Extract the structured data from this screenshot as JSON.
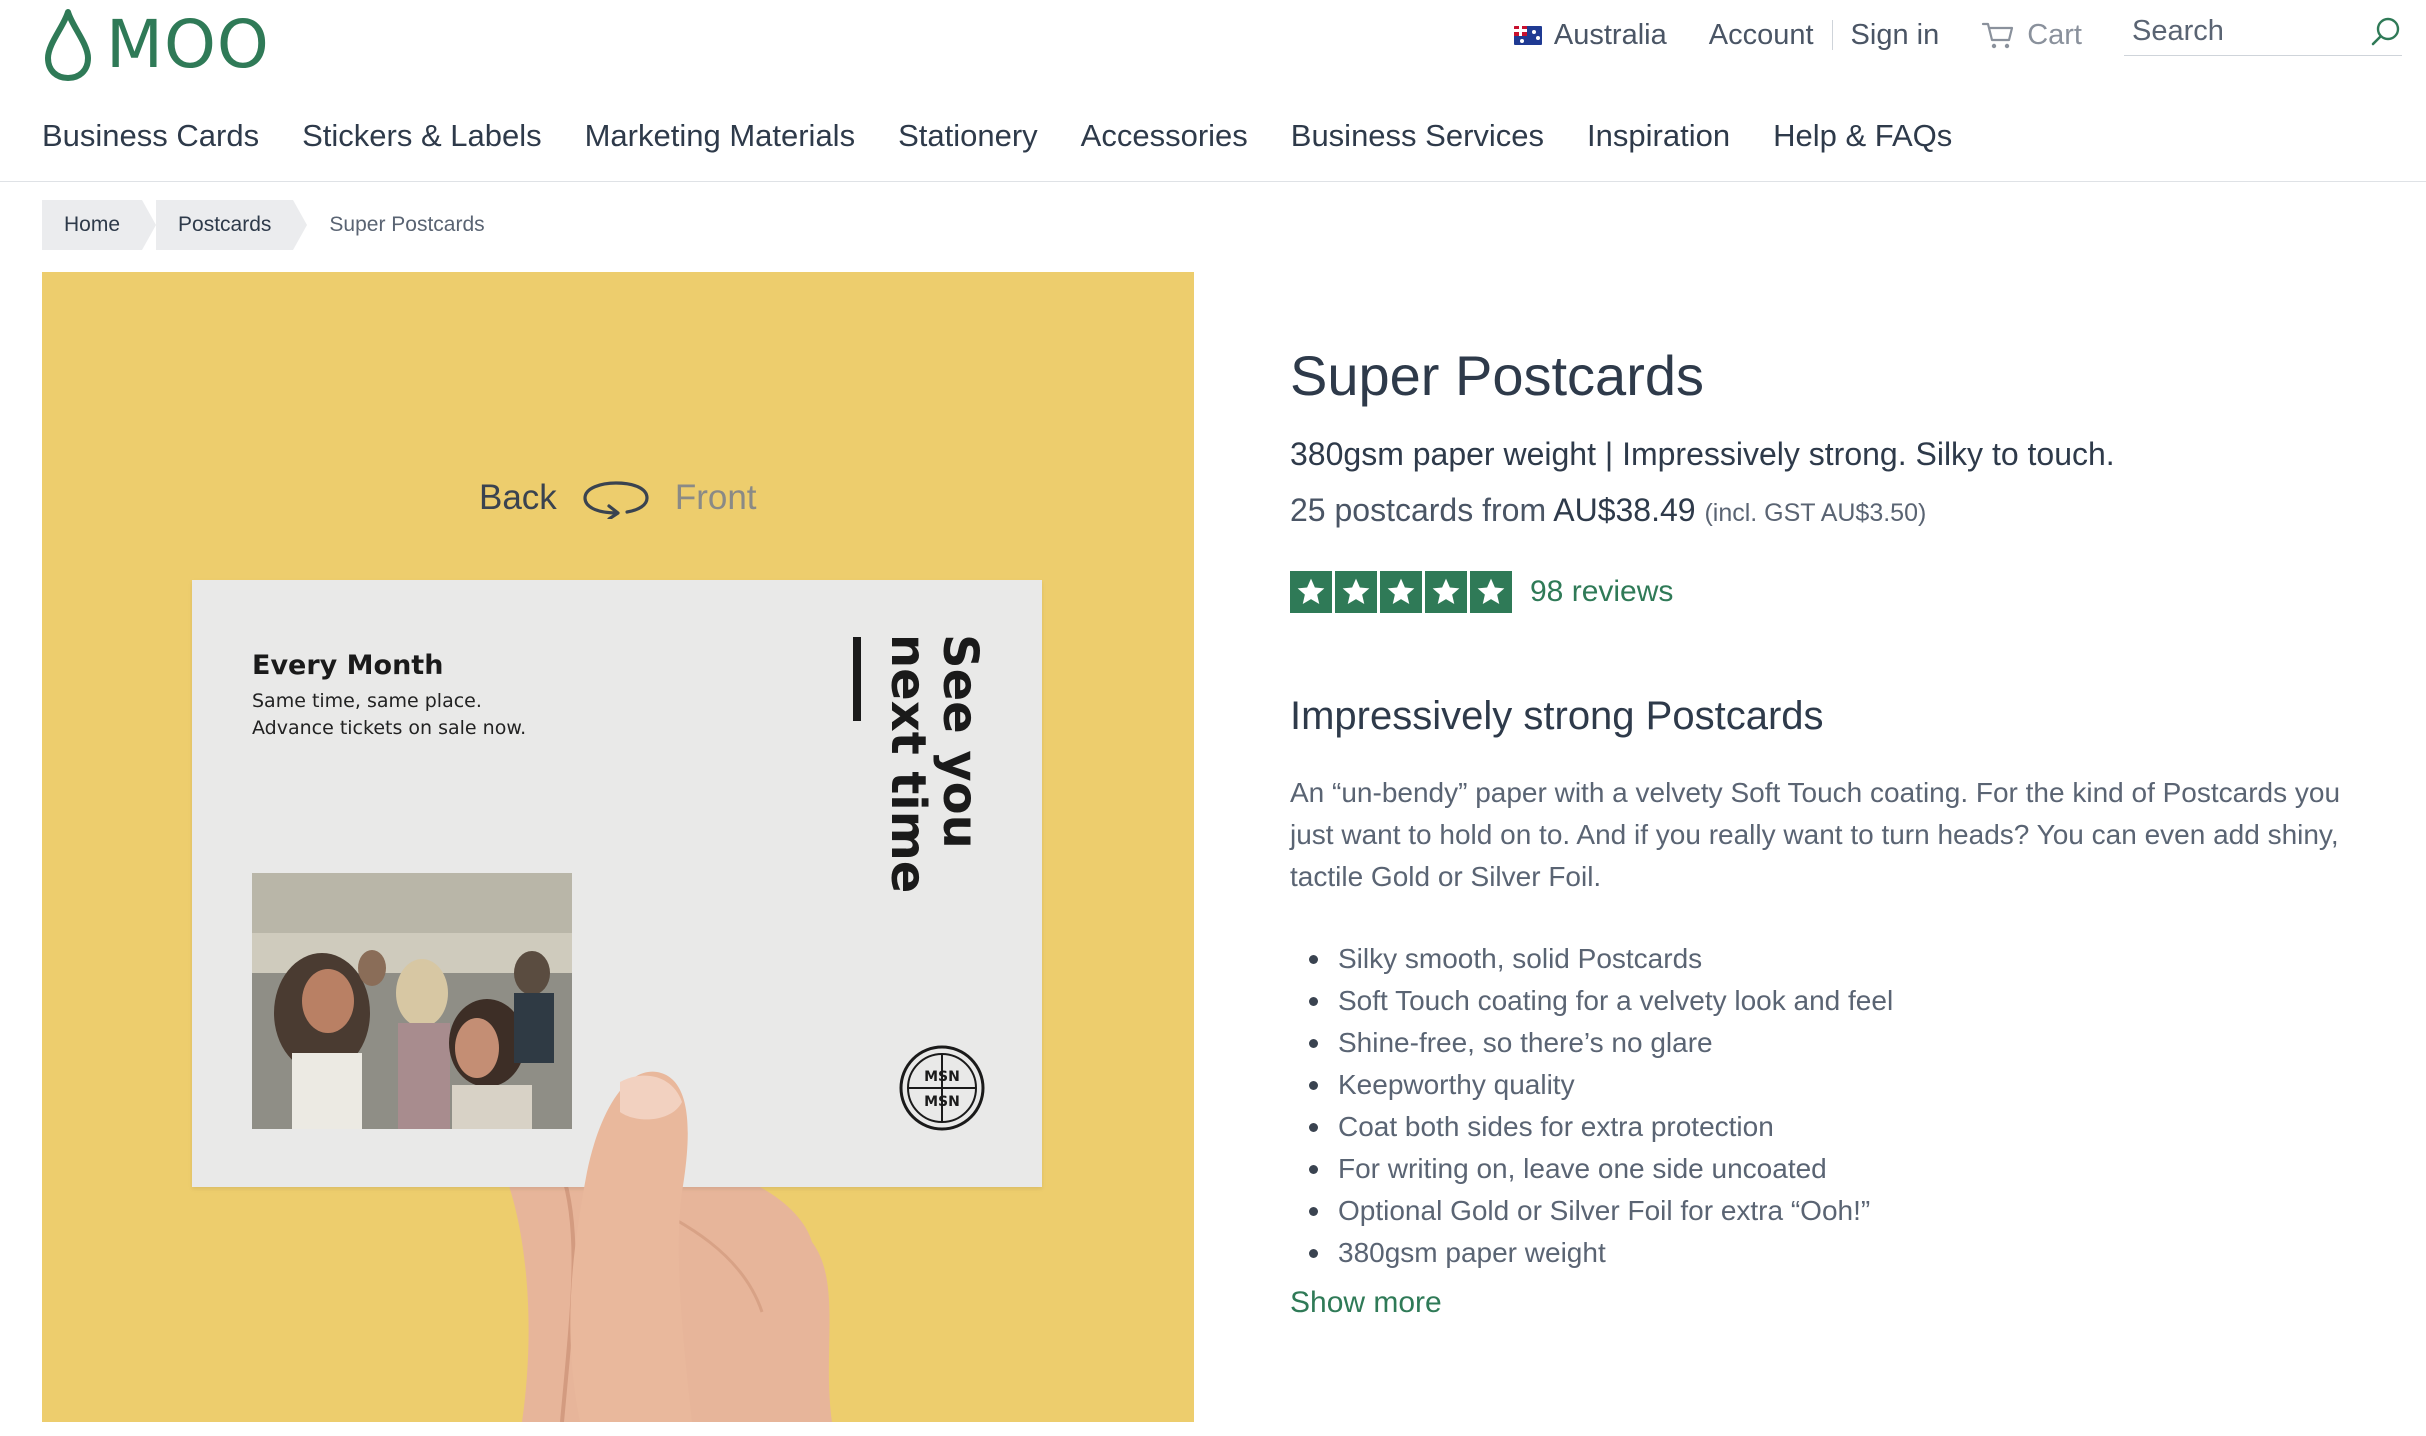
{
  "brand": {
    "logo_text": "MOO",
    "color": "#2f7a57"
  },
  "utility_nav": {
    "country": "Australia",
    "account": "Account",
    "sign_in": "Sign in",
    "cart": "Cart",
    "search_placeholder": "Search"
  },
  "main_nav": {
    "items": [
      "Business Cards",
      "Stickers & Labels",
      "Marketing Materials",
      "Stationery",
      "Accessories",
      "Business Services",
      "Inspiration",
      "Help & FAQs"
    ]
  },
  "breadcrumb": [
    "Home",
    "Postcards",
    "Super Postcards"
  ],
  "hero": {
    "background": "#edcd6d",
    "flip_back": "Back",
    "flip_front": "Front",
    "card_heading": "Every Month",
    "card_line1": "Same time, same place.",
    "card_line2": "Advance tickets on sale now.",
    "card_vertical": "See you\nnext time",
    "seal_letters": "MSN"
  },
  "product": {
    "title": "Super Postcards",
    "tagline": "380gsm paper weight | Impressively strong. Silky to touch.",
    "price_prefix": "25 postcards from",
    "price_amount": "AU$38.49",
    "price_gst": "(incl. GST AU$3.50)",
    "rating_stars": 5,
    "reviews": "98 reviews",
    "section_heading": "Impressively strong Postcards",
    "description": "An “un-bendy” paper with a velvety Soft Touch coating. For the kind of Postcards you just want to hold on to. And if you really want to turn heads? You can even add shiny, tactile Gold or Silver Foil.",
    "features": [
      "Silky smooth, solid Postcards",
      "Soft Touch coating for a velvety look and feel",
      "Shine-free, so there’s no glare",
      "Keepworthy quality",
      "Coat both sides for extra protection",
      "For writing on, leave one side uncoated",
      "Optional Gold or Silver Foil for extra “Ooh!”",
      "380gsm paper weight"
    ],
    "show_more": "Show more"
  },
  "icons": {
    "logo": "moo-drop-icon",
    "flag": "australia-flag-icon",
    "cart": "cart-icon",
    "search": "search-icon",
    "flip": "flip-arrow-icon",
    "star": "star-icon"
  }
}
